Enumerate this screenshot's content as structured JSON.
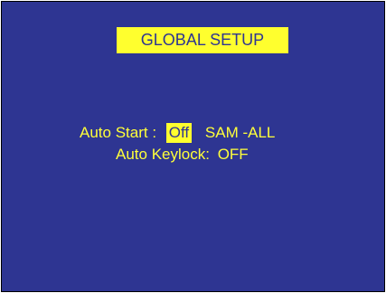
{
  "screen": {
    "title": "GLOBAL SETUP",
    "background_color": "#2e3592",
    "text_color": "#ffff3a",
    "highlight_color": "#ffff2e"
  },
  "settings": {
    "auto_start": {
      "label": "Auto  Start :",
      "selected_value": "Off",
      "alternate_value": "SAM -ALL"
    },
    "auto_keylock": {
      "label": "Auto Keylock:",
      "value": "OFF"
    }
  }
}
